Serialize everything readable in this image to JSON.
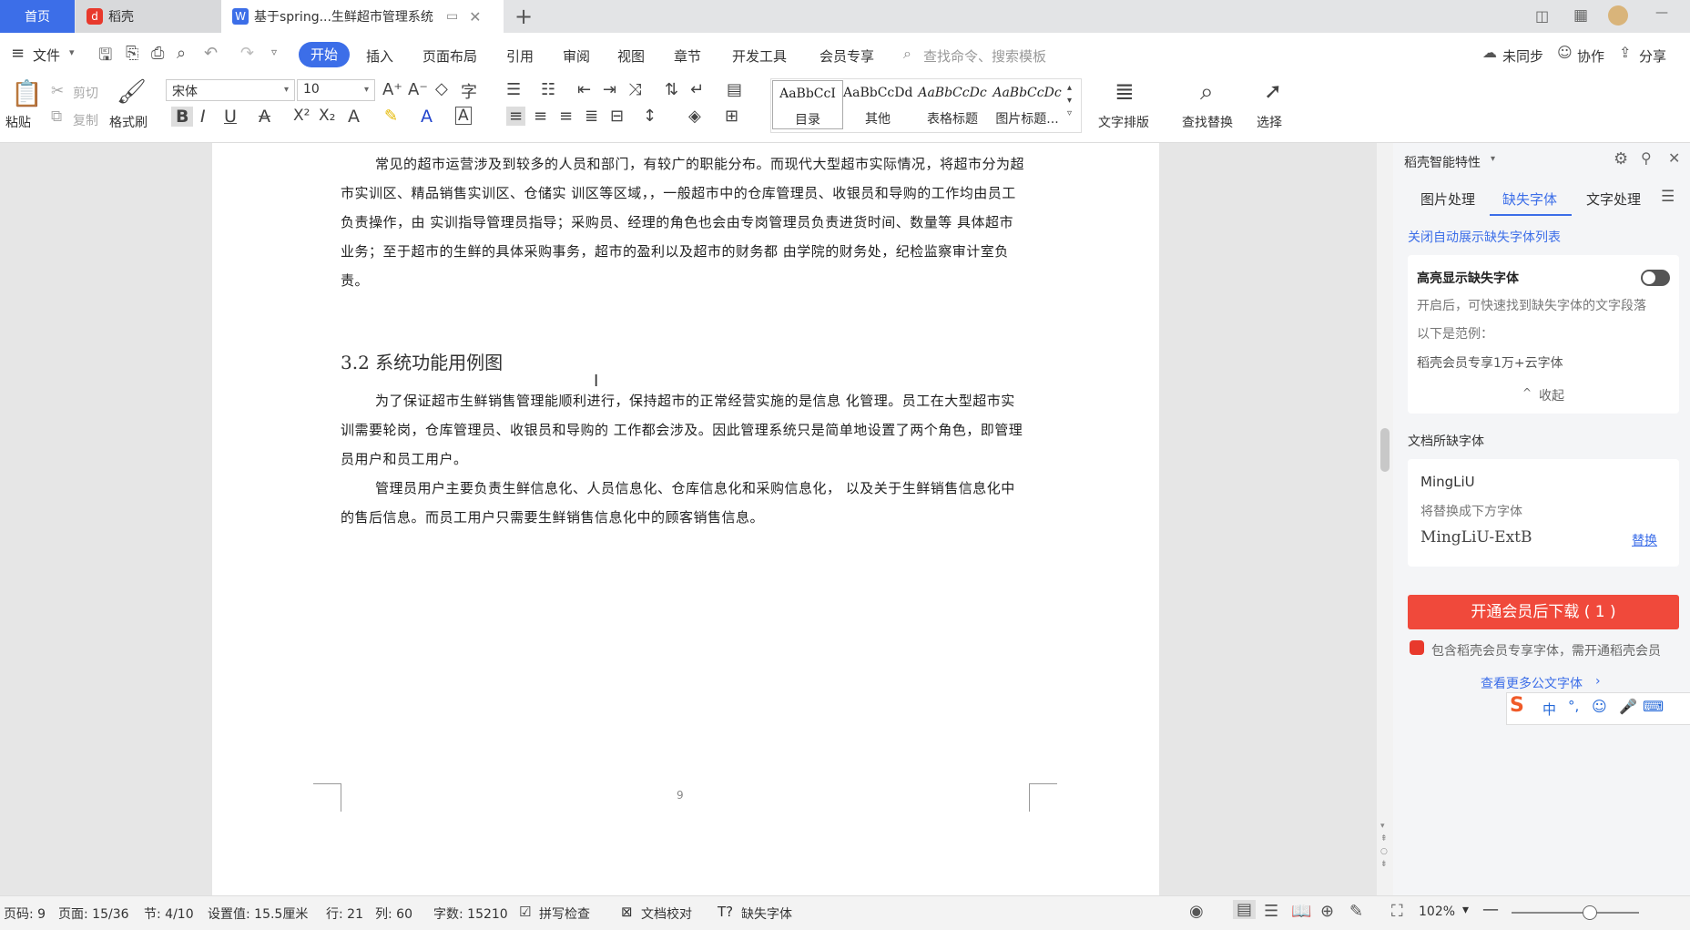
{
  "tabs": {
    "home": "首页",
    "wps": "稻壳",
    "doc": "基于spring...生鲜超市管理系统"
  },
  "menu": {
    "file": "文件",
    "items": [
      "开始",
      "插入",
      "页面布局",
      "引用",
      "审阅",
      "视图",
      "章节",
      "开发工具",
      "会员专享"
    ],
    "search_placeholder": "查找命令、搜索模板",
    "sync": "未同步",
    "collab": "协作",
    "share": "分享"
  },
  "ribbon": {
    "paste": "粘贴",
    "cut": "剪切",
    "copy": "复制",
    "format_painter": "格式刷",
    "font_name": "宋体",
    "font_size": "10",
    "styles": [
      {
        "sample": "AaBbCcI",
        "name": "目录"
      },
      {
        "sample": "AaBbCcDd",
        "name": "其他"
      },
      {
        "sample": "AaBbCcDc",
        "name": "表格标题"
      },
      {
        "sample": "AaBbCcDc",
        "name": "图片标题..."
      }
    ],
    "text_layout": "文字排版",
    "find_replace": "查找替换",
    "select": "选择"
  },
  "document": {
    "para1": "常见的超市运营涉及到较多的人员和部门，有较广的职能分布。而现代大型超市实际情况，将超市分为超市实训区、精品销售实训区、仓储实 训区等区域，，一般超市中的仓库管理员、收银员和导购的工作均由员工负责操作，由 实训指导管理员指导；采购员、经理的角色也会由专岗管理员负责进货时间、数量等 具体超市业务；至于超市的生鲜的具体采购事务，超市的盈利以及超市的财务都 由学院的财务处，纪检监察审计室负责。",
    "heading": "3.2 系统功能用例图",
    "para2": "为了保证超市生鲜销售管理能顺利进行，保持超市的正常经营实施的是信息 化管理。员工在大型超市实训需要轮岗，仓库管理员、收银员和导购的 工作都会涉及。因此管理系统只是简单地设置了两个角色，即管理员用户和员工用户。",
    "para3": "管理员用户主要负责生鲜信息化、人员信息化、仓库信息化和采购信息化， 以及关于生鲜销售信息化中的售后信息。而员工用户只需要生鲜销售信息化中的顾客销售信息。",
    "page_number": "9"
  },
  "side_panel": {
    "title": "稻壳智能特性",
    "tabs": [
      "图片处理",
      "缺失字体",
      "文字处理"
    ],
    "active_tab": "缺失字体",
    "close_auto": "关闭自动展示缺失字体列表",
    "highlight_title": "高亮显示缺失字体",
    "highlight_desc": "开启后，可快速找到缺失字体的文字段落",
    "example_label": "以下是范例：",
    "example_value": "稻壳会员专享1万+云字体",
    "collapse": "收起",
    "missing_title": "文档所缺字体",
    "missing_font": "MingLiU",
    "replace_hint": "将替换成下方字体",
    "replace_font": "MingLiU-ExtB",
    "replace_btn": "替换",
    "download_btn": "开通会员后下载 ( 1 )",
    "member_note": "包含稻壳会员专享字体，需开通稻壳会员",
    "more_fonts": "查看更多公文字体"
  },
  "ime": {
    "mode": "中",
    "punct": "°,"
  },
  "status": {
    "page_code": "页码: 9",
    "page": "页面: 15/36",
    "section": "节: 4/10",
    "setting": "设置值: 15.5厘米",
    "row": "行: 21",
    "col": "列: 60",
    "word_count": "字数: 15210",
    "spell_check": "拼写检查",
    "proofread": "文档校对",
    "missing_font": "缺失字体",
    "zoom": "102%"
  },
  "colors": {
    "accent": "#3c6ee8",
    "download": "#f0493b",
    "link": "#3c6ee8"
  }
}
